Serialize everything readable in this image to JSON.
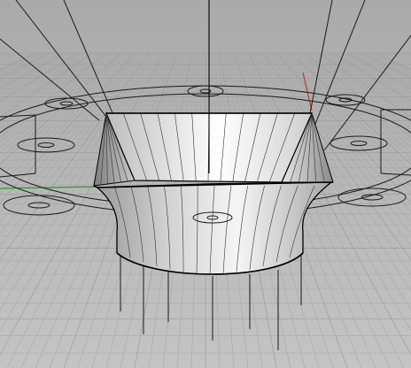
{
  "viewport": {
    "kind": "perspective-3d-viewport",
    "colors": {
      "background_top": "#aaaaaa",
      "background_bottom": "#c4c4c4",
      "grid_minor": "#a7a7a7",
      "grid_major": "#969696",
      "curve": "#1a1a1a",
      "edge": "#000000",
      "surface_light": "#f4f4f4",
      "surface_mid": "#cfcfcf",
      "surface_dark": "#8e8e8e",
      "axis_x": "#c0392b",
      "axis_y": "#2a9d2a"
    },
    "icons": {
      "world_axis_x": "axis-x-icon",
      "world_axis_y": "axis-y-icon"
    }
  }
}
